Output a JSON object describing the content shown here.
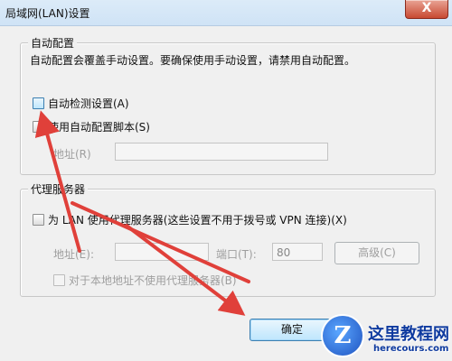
{
  "window": {
    "title": "局域网(LAN)设置",
    "close_glyph": "X"
  },
  "auto_config": {
    "group_title": "自动配置",
    "description": "自动配置会覆盖手动设置。要确保使用手动设置，请禁用自动配置。",
    "auto_detect_label": "自动检测设置(A)",
    "auto_detect_checked": false,
    "use_script_label": "使用自动配置脚本(S)",
    "use_script_checked": false,
    "address_label": "地址(R)",
    "address_value": ""
  },
  "proxy": {
    "group_title": "代理服务器",
    "use_proxy_label": "为 LAN 使用代理服务器(这些设置不用于拨号或 VPN 连接)(X)",
    "use_proxy_checked": false,
    "address_label": "地址(E):",
    "address_value": "",
    "port_label": "端口(T):",
    "port_value": "80",
    "advanced_label": "高级(C)",
    "bypass_local_label": "对于本地地址不使用代理服务器(B)",
    "bypass_local_checked": false
  },
  "footer": {
    "ok_label": "确定"
  },
  "watermark": {
    "logo_letter": "Z",
    "site_name": "这里教程网",
    "site_url": "herecours.com"
  },
  "colors": {
    "annotation_arrow": "#e0403a",
    "titlebar_close": "#c84932",
    "default_button_border": "#3c7fb1"
  }
}
